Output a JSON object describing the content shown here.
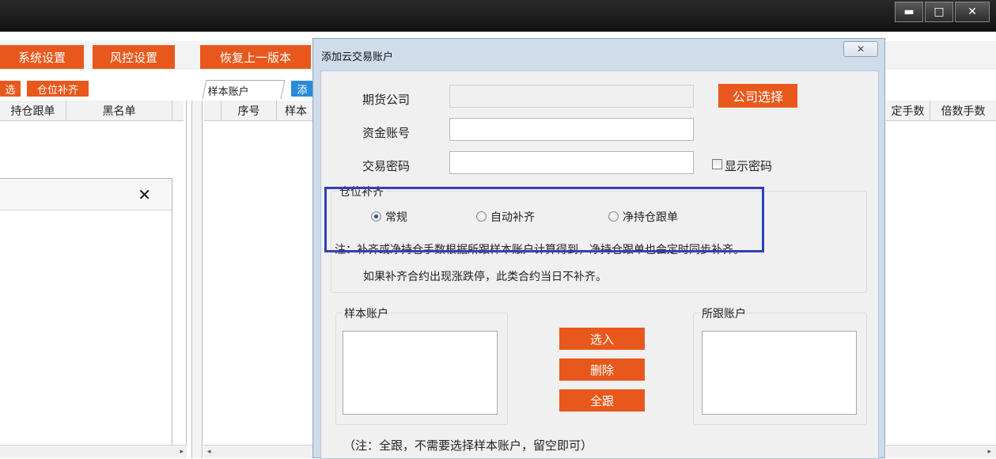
{
  "window": {
    "minimize_label": "▬",
    "maximize_label": "□",
    "close_label": "✕"
  },
  "toolbar": {
    "system_settings": "系统设置",
    "risk_settings": "风控设置",
    "restore_version": "恢复上一版本"
  },
  "left_tabs": {
    "filter_label": "选",
    "position_fill_label": "仓位补齐"
  },
  "left_table": {
    "columns": [
      "持仓跟单",
      "黑名单"
    ]
  },
  "center_tabs": {
    "sample_account_tab": "样本账户",
    "add_tab": "添"
  },
  "center_table": {
    "columns": [
      "序号",
      "样本"
    ]
  },
  "right_table": {
    "columns": [
      "定手数",
      "倍数手数"
    ]
  },
  "subpanel": {
    "close_label": "✕"
  },
  "dialog": {
    "title": "添加云交易账户",
    "close_label": "✕",
    "futures_company_label": "期货公司",
    "futures_company_value": "",
    "company_select_button": "公司选择",
    "fund_account_label": "资金账号",
    "fund_account_value": "",
    "trade_password_label": "交易密码",
    "trade_password_value": "",
    "show_password_label": "显示密码",
    "position_fill_group": "仓位补齐",
    "radio_options": [
      "常规",
      "自动补齐",
      "净持仓跟单"
    ],
    "selected_option": "常规",
    "note_line1": "注：补齐或净持仓手数根据所跟样本账户计算得到，净持仓跟单也会定时同步补齐。",
    "note_line2": "如果补齐合约出现涨跌停，此类合约当日不补齐。",
    "sample_account_group": "样本账户",
    "followed_account_group": "所跟账户",
    "select_in_button": "选入",
    "delete_button": "删除",
    "follow_all_button": "全跟",
    "follow_all_note": "（注：全跟，不需要选择样本账户，留空即可）"
  },
  "colors": {
    "accent_orange": "#e8581c",
    "highlight_blue": "#3041b3"
  }
}
